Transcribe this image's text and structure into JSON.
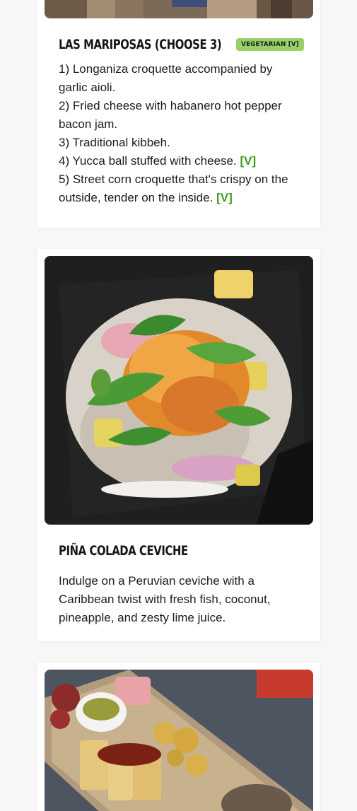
{
  "items": [
    {
      "title": "LAS MARIPOSAS (CHOOSE 3)",
      "badge": "VEGETARIAN [V]",
      "lines": [
        {
          "text": "1) Longaniza croquette accompanied by garlic aioli.",
          "tag": ""
        },
        {
          "text": "2) Fried cheese with habanero hot pepper bacon jam.",
          "tag": ""
        },
        {
          "text": "3) Traditional kibbeh.",
          "tag": ""
        },
        {
          "text": "4) Yucca ball stuffed with cheese.",
          "tag": "[V]"
        },
        {
          "text": "5) Street corn croquette that's crispy on the outside, tender on the inside.",
          "tag": "[V]"
        }
      ]
    },
    {
      "title": "PIÑA COLADA CEVICHE",
      "description": "Indulge on a Peruvian ceviche with a Caribbean twist with fresh fish, coconut, pineapple, and zesty lime juice."
    }
  ],
  "colors": {
    "badge": "#98d06a",
    "veg_tag": "#3c9b1a",
    "text": "#1b1b1b"
  }
}
